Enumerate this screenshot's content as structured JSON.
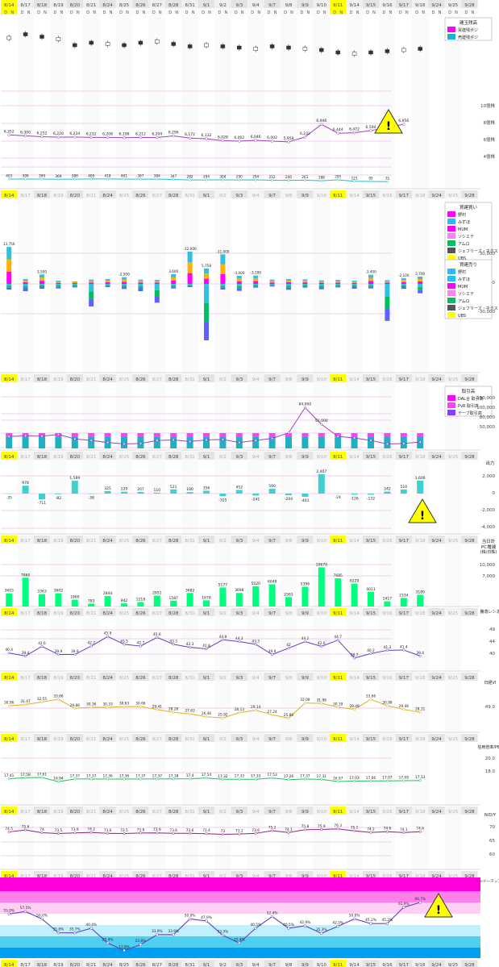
{
  "dates": [
    "8/14",
    "8/17",
    "8/18",
    "8/19",
    "8/20",
    "8/21",
    "8/24",
    "8/25",
    "8/26",
    "8/27",
    "8/28",
    "8/31",
    "9/1",
    "9/2",
    "9/3",
    "9/4",
    "9/7",
    "9/8",
    "9/9",
    "9/10",
    "9/11",
    "9/14",
    "9/15",
    "9/16",
    "9/17",
    "9/18",
    "9/24",
    "9/25",
    "9/28"
  ],
  "dn_labels": [
    "D",
    "N"
  ],
  "colors": {
    "accent_yellow": "#ffff00",
    "purple": "#a040c0",
    "cyan": "#20c0d0",
    "green": "#00ff80",
    "orange": "#ffb000",
    "magenta": "#ff00ff",
    "pink_line": "#ff80ff"
  },
  "chart_data": [
    {
      "type": "line",
      "legend_title": "建玉残高",
      "legend": [
        "買建残ポジ",
        "売建残ポジ"
      ],
      "right_ticks": [
        "10億株",
        "8億株",
        "6億株",
        "4億株"
      ],
      "ohlc_hint": [
        0.2,
        0.5,
        0.3,
        0.1,
        -0.4,
        -0.2,
        -0.3,
        -0.4,
        -0.2,
        -0.1,
        -0.3,
        -0.5,
        -0.4,
        -0.5,
        -0.6,
        -0.7,
        -0.5,
        -0.6,
        -0.7,
        -0.8,
        -1.0,
        -1.1,
        -1.0,
        -0.9,
        -0.8,
        -0.7
      ],
      "series": [
        {
          "name": "買建残ポジ",
          "values": [
            6352,
            6300,
            6252,
            6220,
            6234,
            6212,
            6208,
            6196,
            6212,
            6204,
            6296,
            6172,
            6132,
            6028,
            6002,
            6046,
            6002,
            5958,
            6232,
            6946,
            6444,
            6472,
            6594,
            6766,
            6956,
            null,
            null,
            null,
            null
          ]
        },
        {
          "name": "売建残ポジ",
          "values": [
            403,
            399,
            399,
            369,
            388,
            409,
            418,
            401,
            387,
            384,
            347,
            282,
            294,
            304,
            290,
            294,
            252,
            240,
            261,
            188,
            295,
            121,
            95,
            75,
            null,
            null,
            null,
            null,
            null
          ]
        }
      ]
    },
    {
      "type": "bar",
      "legend_buy_title": "買建買い",
      "legend_sell_title": "買建売り",
      "legend_items": [
        "野村",
        "みずほ",
        "MUM",
        "ソシエテ",
        "アムロ",
        "ジェフリーズ・ネクスト",
        "UBS"
      ],
      "right_ticks": [
        "30,000",
        "0",
        "-30,000"
      ],
      "values": [
        13756,
        -2100,
        -1800,
        2700,
        3500,
        -1800,
        1200,
        -1700,
        900,
        -1300,
        1600,
        8380,
        -1800,
        -1200,
        -2500,
        1900,
        -1600,
        -2700,
        -1500,
        -7000,
        3600,
        -1700,
        -12000,
        -1200,
        5758,
        62533,
        -11000,
        -2100,
        -3000,
        2600,
        -3100,
        1400,
        -1600,
        1000,
        -1800,
        2200,
        -1700,
        1400,
        -1300,
        2000,
        -1500,
        1300,
        -1200,
        -1800,
        -3400,
        1700,
        -1400
      ]
    },
    {
      "type": "area",
      "legend_title": "取引高",
      "legend": [
        "DAL合 取引高",
        "PvR 取引高",
        "テーブ取引高"
      ],
      "right_ticks": [
        "150,000",
        "100,000",
        "80,000",
        "50,000"
      ],
      "values": [
        27000,
        28000,
        27500,
        31000,
        22000,
        19000,
        15000,
        12000,
        13000,
        19000,
        20000,
        17000,
        20000,
        21000,
        15000,
        19000,
        23000,
        34000,
        84000,
        51000,
        27000,
        24000,
        19000,
        12000,
        13000,
        16000
      ]
    },
    {
      "type": "bar",
      "title": "出力",
      "right_ticks": [
        "2,000",
        "0",
        "-2,000",
        "-4,000"
      ],
      "values": [
        -35,
        978,
        -711,
        -82,
        1589,
        -38,
        325,
        229,
        207,
        110,
        521,
        180,
        356,
        -325,
        452,
        -241,
        590,
        -204,
        -401,
        2407,
        -24,
        -126,
        -132,
        242,
        510,
        1606
      ]
    },
    {
      "type": "bar",
      "title": "当日計",
      "subtitle": "PC増減",
      "subtitle2": "(株/日株)",
      "right_ticks": [
        "10,000",
        "7,000"
      ],
      "values": [
        3603,
        7860,
        3363,
        3602,
        1860,
        783,
        2844,
        842,
        1218,
        2951,
        1587,
        3682,
        1678,
        5177,
        3698,
        5520,
        6048,
        2561,
        5396,
        10679,
        7685,
        6229,
        4011,
        1417,
        2334,
        3189
      ]
    },
    {
      "type": "line",
      "title": "騰落レシオ",
      "right_ticks": [
        "49",
        "44",
        "40"
      ],
      "values": [
        40.4,
        39.4,
        42.6,
        39.9,
        39.9,
        42.7,
        45.9,
        43.3,
        42.7,
        45.6,
        43.3,
        42.3,
        41.8,
        44.8,
        44.2,
        43.3,
        39.9,
        42.0,
        44.2,
        42.6,
        44.7,
        38.7,
        40.2,
        41.3,
        41.4,
        39.4
      ]
    },
    {
      "type": "line",
      "title": "日経VI",
      "right_ticks": [
        "49.0"
      ],
      "values": [
        30.96,
        31.47,
        32.55,
        33.66,
        29.86,
        30.36,
        30.33,
        30.63,
        30.66,
        29.41,
        28.26,
        27.63,
        26.46,
        25.92,
        28.13,
        29.14,
        27.24,
        25.86,
        32.09,
        31.96,
        30.39,
        29.49,
        33.66,
        30.99,
        29.46,
        28.31
      ]
    },
    {
      "type": "line",
      "title": "信用倍率/PER",
      "right_ticks": [
        "20.0",
        "18.0"
      ],
      "values": [
        17.41,
        17.58,
        17.61,
        16.94,
        17.37,
        17.37,
        17.36,
        17.36,
        17.37,
        17.37,
        17.38,
        17.4,
        17.54,
        17.32,
        17.33,
        17.33,
        17.53,
        17.26,
        17.37,
        17.31,
        16.97,
        17.03,
        17.06,
        17.07,
        17.09,
        17.13
      ]
    },
    {
      "type": "line",
      "title": "N/D/Y",
      "right_ticks": [
        "70",
        "65",
        "60"
      ],
      "values": [
        74.5,
        75.6,
        74.0,
        73.5,
        73.9,
        74.2,
        73.6,
        73.5,
        73.8,
        73.9,
        73.6,
        73.6,
        73.4,
        73.0,
        73.2,
        73.6,
        75.2,
        74.1,
        75.8,
        75.9,
        76.3,
        75.1,
        74.2,
        74.6,
        74.1,
        74.6
      ]
    },
    {
      "type": "line",
      "title": "シャドーマップ",
      "values": [
        55.0,
        57.5,
        50.0,
        35.8,
        35.7,
        40.4,
        25.4,
        17.8,
        23.8,
        33.9,
        33.9,
        50.0,
        47.9,
        33.3,
        25.4,
        40.5,
        52.4,
        40.5,
        42.9,
        35.3,
        42.5,
        50.0,
        45.2,
        45.2,
        61.9,
        66.7
      ],
      "labels": [
        "55.0%",
        "57.5%",
        "50.0%",
        "35.8%",
        "35.7%",
        "40.4%",
        "25.4%",
        "17.8%",
        "23.8%",
        "33.9%",
        "33.9%",
        "50.0%",
        "47.9%",
        "33.3%",
        "25.4%",
        "40.5%",
        "52.4%",
        "40.5%",
        "42.9%",
        "35.3%",
        "42.5%",
        "50.0%",
        "45.2%",
        "45.2%",
        "61.9%",
        "66.7%"
      ]
    }
  ]
}
